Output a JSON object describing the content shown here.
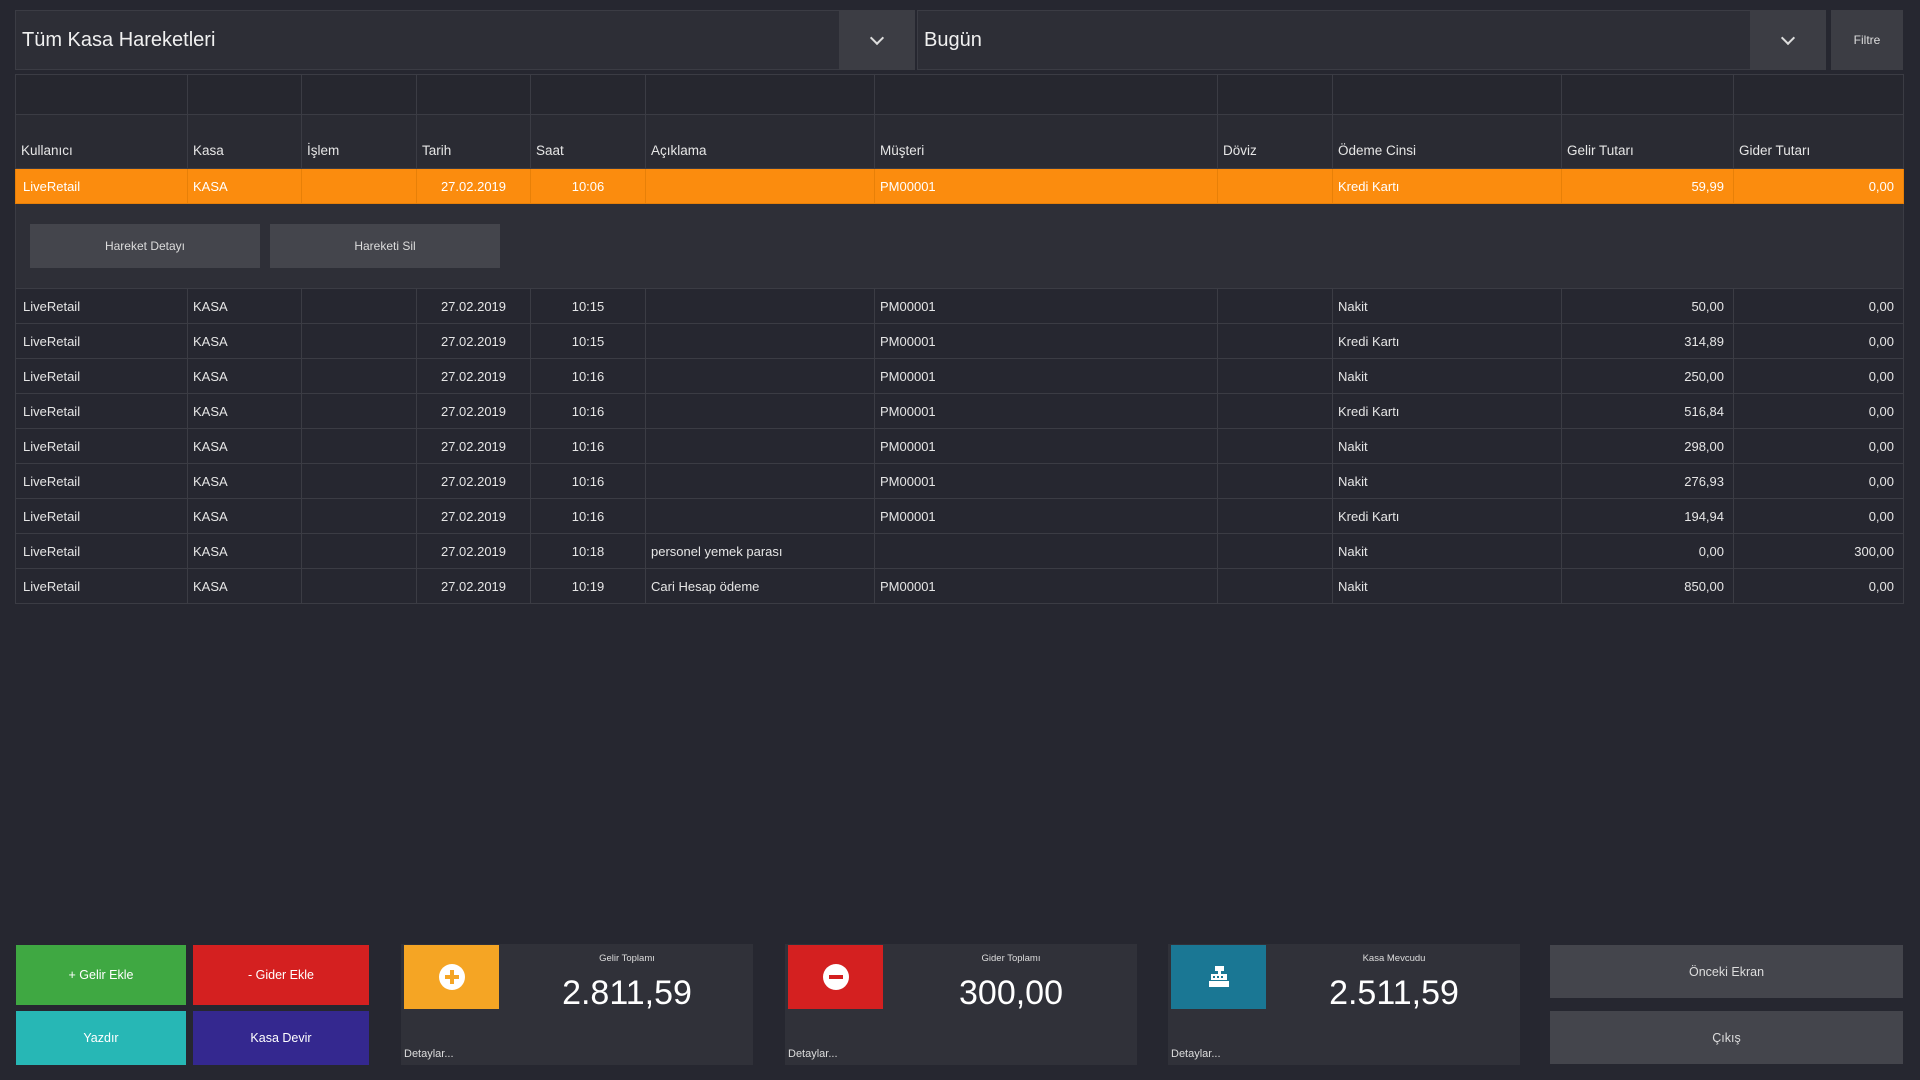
{
  "filters": {
    "movement_type": "Tüm Kasa Hareketleri",
    "period": "Bugün",
    "filter_label": "Filtre"
  },
  "columns": [
    "Kullanıcı",
    "Kasa",
    "İşlem",
    "Tarih",
    "Saat",
    "Açıklama",
    "Müşteri",
    "Döviz",
    "Ödeme Cinsi",
    "Gelir Tutarı",
    "Gider Tutarı"
  ],
  "rows": [
    [
      "LiveRetail",
      "KASA",
      "",
      "27.02.2019",
      "10:06",
      "",
      "PM00001",
      "",
      "Kredi Kartı",
      "59,99",
      "0,00"
    ],
    [
      "LiveRetail",
      "KASA",
      "",
      "27.02.2019",
      "10:15",
      "",
      "PM00001",
      "",
      "Nakit",
      "50,00",
      "0,00"
    ],
    [
      "LiveRetail",
      "KASA",
      "",
      "27.02.2019",
      "10:15",
      "",
      "PM00001",
      "",
      "Kredi Kartı",
      "314,89",
      "0,00"
    ],
    [
      "LiveRetail",
      "KASA",
      "",
      "27.02.2019",
      "10:16",
      "",
      "PM00001",
      "",
      "Nakit",
      "250,00",
      "0,00"
    ],
    [
      "LiveRetail",
      "KASA",
      "",
      "27.02.2019",
      "10:16",
      "",
      "PM00001",
      "",
      "Kredi Kartı",
      "516,84",
      "0,00"
    ],
    [
      "LiveRetail",
      "KASA",
      "",
      "27.02.2019",
      "10:16",
      "",
      "PM00001",
      "",
      "Nakit",
      "298,00",
      "0,00"
    ],
    [
      "LiveRetail",
      "KASA",
      "",
      "27.02.2019",
      "10:16",
      "",
      "PM00001",
      "",
      "Nakit",
      "276,93",
      "0,00"
    ],
    [
      "LiveRetail",
      "KASA",
      "",
      "27.02.2019",
      "10:16",
      "",
      "PM00001",
      "",
      "Kredi Kartı",
      "194,94",
      "0,00"
    ],
    [
      "LiveRetail",
      "KASA",
      "",
      "27.02.2019",
      "10:18",
      "personel yemek parası",
      "",
      "",
      "Nakit",
      "0,00",
      "300,00"
    ],
    [
      "LiveRetail",
      "KASA",
      "",
      "27.02.2019",
      "10:19",
      "Cari Hesap ödeme",
      "PM00001",
      "",
      "Nakit",
      "850,00",
      "0,00"
    ]
  ],
  "row_detail": {
    "detail_button": "Hareket Detayı",
    "delete_button": "Hareketi Sil"
  },
  "actions": {
    "add_income": "+ Gelir Ekle",
    "add_expense": "- Gider Ekle",
    "print": "Yazdır",
    "transfer": "Kasa Devir"
  },
  "summary": {
    "income": {
      "title": "Gelir Toplamı",
      "value": "2.811,59",
      "details": "Detaylar...",
      "icon": "plus-circle-icon"
    },
    "expense": {
      "title": "Gider Toplamı",
      "value": "300,00",
      "details": "Detaylar...",
      "icon": "minus-circle-icon"
    },
    "balance": {
      "title": "Kasa Mevcudu",
      "value": "2.511,59",
      "details": "Detaylar...",
      "icon": "cash-register-icon"
    }
  },
  "nav": {
    "previous": "Önceki Ekran",
    "exit": "Çıkış"
  },
  "colors": {
    "background": "#262730",
    "selected_row": "#fb8c0e",
    "income_green": "#3fa842",
    "expense_red": "#d42020",
    "print_teal": "#27b7b5",
    "transfer_indigo": "#34288f",
    "income_icon_bg": "#f5a524",
    "expense_icon_bg": "#d42020",
    "balance_icon_bg": "#1a7794"
  }
}
